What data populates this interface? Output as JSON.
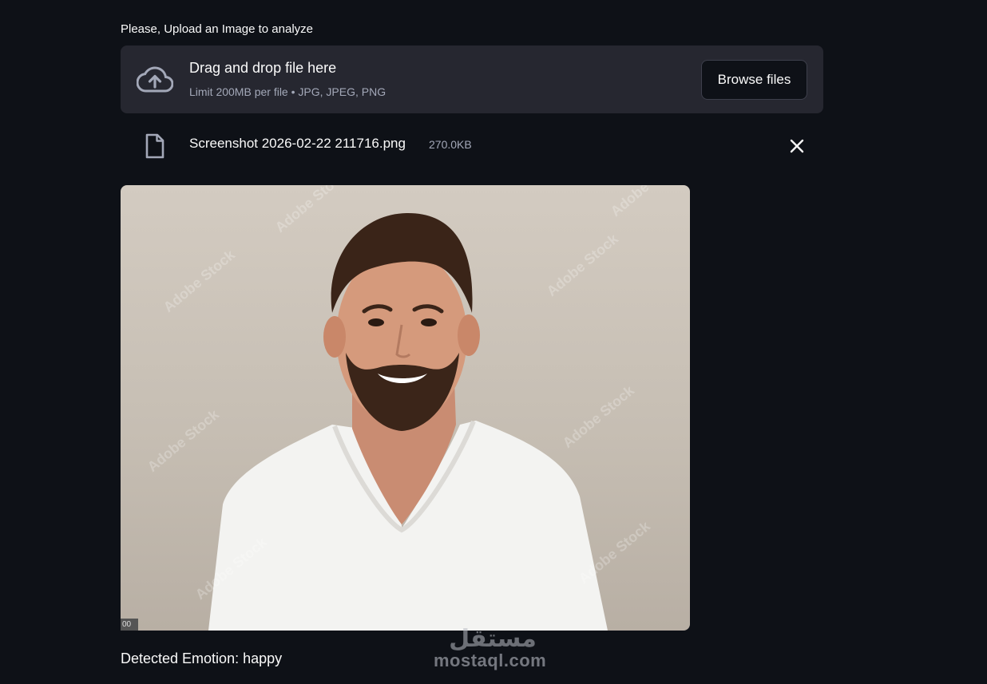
{
  "uploader": {
    "label": "Please, Upload an Image to analyze",
    "dropzone_title": "Drag and drop file here",
    "dropzone_limit": "Limit 200MB per file • JPG, JPEG, PNG",
    "browse_label": "Browse files",
    "icon": "cloud-upload-icon"
  },
  "uploaded_file": {
    "name": "Screenshot 2026-02-22 211716.png",
    "size": "270.0KB",
    "icon": "file-icon",
    "remove_icon": "close-icon"
  },
  "preview": {
    "corner_badge": "00",
    "watermark_text": "Adobe Stock"
  },
  "result": {
    "text": "Detected Emotion: happy"
  },
  "site_watermark": {
    "logo_text": "مستقل",
    "text": "mostaql.com"
  },
  "colors": {
    "background": "#0e1117",
    "dropzone": "#262730",
    "text": "#fafafa",
    "muted": "#a3a8b8"
  }
}
